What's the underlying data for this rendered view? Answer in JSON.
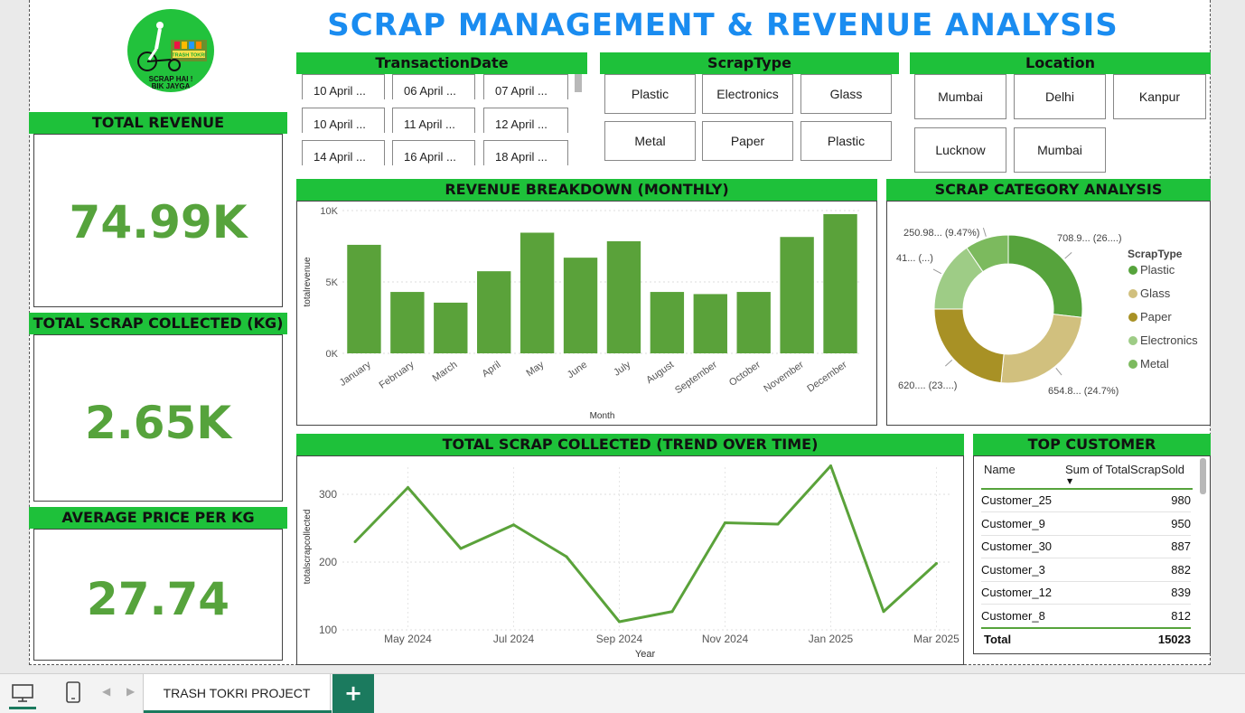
{
  "title": "SCRAP MANAGEMENT & REVENUE ANALYSIS",
  "logo": {
    "line1": "SCRAP HAI !",
    "line2": "BIK JAYGA",
    "sign": "TRASH TOKRI"
  },
  "kpis": {
    "revenue": {
      "label": "TOTAL REVENUE",
      "value": "74.99K"
    },
    "scrap": {
      "label": "TOTAL SCRAP COLLECTED (KG)",
      "value": "2.65K"
    },
    "price": {
      "label": "AVERAGE PRICE PER KG",
      "value": "27.74"
    }
  },
  "slicers": {
    "date": {
      "label": "TransactionDate",
      "items": [
        "10 April ...",
        "06 April ...",
        "07 April ...",
        "10 April ...",
        "11 April ...",
        "12 April ...",
        "14 April ...",
        "16 April ...",
        "18 April ..."
      ]
    },
    "scraptype": {
      "label": "ScrapType",
      "items": [
        "Plastic",
        "Electronics",
        "Glass",
        "Metal",
        "Paper",
        "Plastic"
      ]
    },
    "location": {
      "label": "Location",
      "items": [
        "Mumbai",
        "Delhi",
        "Kanpur",
        "Lucknow",
        "Mumbai"
      ]
    }
  },
  "charts": {
    "revenue": {
      "header": "REVENUE BREAKDOWN (MONTHLY)"
    },
    "category": {
      "header": "SCRAP CATEGORY ANALYSIS"
    },
    "trend": {
      "header": "TOTAL SCRAP COLLECTED (TREND OVER TIME)"
    }
  },
  "chart_data": [
    {
      "type": "bar",
      "categories": [
        "January",
        "February",
        "March",
        "April",
        "May",
        "June",
        "July",
        "August",
        "September",
        "October",
        "November",
        "December"
      ],
      "values": [
        7600,
        4300,
        3550,
        5750,
        8450,
        6700,
        7850,
        4300,
        4150,
        4300,
        8150,
        9750
      ],
      "xlabel": "Month",
      "ylabel": "totalrevenue",
      "ylim": [
        0,
        10000
      ],
      "yticks": [
        "0K",
        "5K",
        "10K"
      ],
      "grid": true,
      "color": "#5aa23a"
    },
    {
      "type": "pie",
      "donut": true,
      "legend_title": "ScrapType",
      "legend_position": "right",
      "series": [
        {
          "name": "Plastic",
          "value": 708.9,
          "label": "708.9... (26....)",
          "color": "#56a33c"
        },
        {
          "name": "Glass",
          "value": 654.8,
          "label": "654.8... (24.7%)",
          "color": "#d1c07e"
        },
        {
          "name": "Paper",
          "value": 620,
          "label": "620.... (23....)",
          "color": "#a89125"
        },
        {
          "name": "Electronics",
          "value": 410,
          "label": "41... (...)",
          "color": "#9ecc86"
        },
        {
          "name": "Metal",
          "value": 250.98,
          "label": "250.98... (9.47%)",
          "color": "#7cba5e"
        }
      ]
    },
    {
      "type": "line",
      "x": [
        "Apr 2024",
        "May 2024",
        "Jun 2024",
        "Jul 2024",
        "Aug 2024",
        "Sep 2024",
        "Oct 2024",
        "Nov 2024",
        "Dec 2024",
        "Jan 2025",
        "Feb 2025",
        "Mar 2025"
      ],
      "xticks": [
        "May 2024",
        "Jul 2024",
        "Sep 2024",
        "Nov 2024",
        "Jan 2025",
        "Mar 2025"
      ],
      "values": [
        230,
        310,
        220,
        255,
        208,
        112,
        127,
        258,
        256,
        342,
        127,
        198
      ],
      "xlabel": "Year",
      "ylabel": "totalscrapcollected",
      "ylim": [
        100,
        340
      ],
      "yticks": [
        100,
        200,
        300
      ],
      "grid": true,
      "color": "#5aa23a"
    }
  ],
  "table": {
    "header": "TOP CUSTOMER",
    "col1": "Name",
    "col2": "Sum of TotalScrapSold",
    "rows": [
      {
        "name": "Customer_25",
        "value": "980"
      },
      {
        "name": "Customer_9",
        "value": "950"
      },
      {
        "name": "Customer_30",
        "value": "887"
      },
      {
        "name": "Customer_3",
        "value": "882"
      },
      {
        "name": "Customer_12",
        "value": "839"
      },
      {
        "name": "Customer_8",
        "value": "812"
      }
    ],
    "total_label": "Total",
    "total_value": "15023"
  },
  "tabs": {
    "page": "TRASH TOKRI PROJECT",
    "add": "+"
  }
}
